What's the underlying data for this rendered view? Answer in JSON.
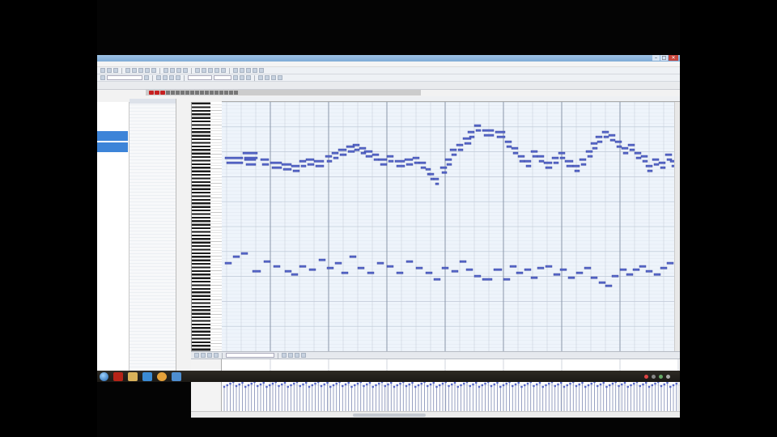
{
  "window": {
    "title": "",
    "menu": [
      "",
      "",
      "",
      "",
      "",
      "",
      "",
      "",
      "",
      "",
      ""
    ],
    "controls": {
      "minimize": "–",
      "maximize": "□",
      "close": "✕"
    }
  },
  "toolbar": {
    "grid_field": "",
    "quantize_field": "",
    "snap_field": ""
  },
  "side_panel": {
    "label": "",
    "selected_items": [
      "",
      ""
    ]
  },
  "event_list": {
    "headers": [
      "",
      "",
      "",
      ""
    ]
  },
  "ruler": {
    "measures": [
      "",
      "",
      "",
      "",
      "",
      "",
      ""
    ]
  },
  "velocity_axis": [
    "",
    ""
  ],
  "taskbar": {
    "icons": [
      "start-orb",
      "media-icon",
      "folder-icon",
      "browser-icon",
      "app-icon",
      "daw-icon"
    ],
    "clock_time": "",
    "clock_date": ""
  },
  "colors": {
    "note_fill": "#5566c8",
    "note_edge": "#2d3a9a",
    "grid_bar": "#8a96aa",
    "grid_beat": "#c3cad6",
    "roll_bg": "#eef4fb",
    "selection_blue": "#3d84d8"
  }
}
